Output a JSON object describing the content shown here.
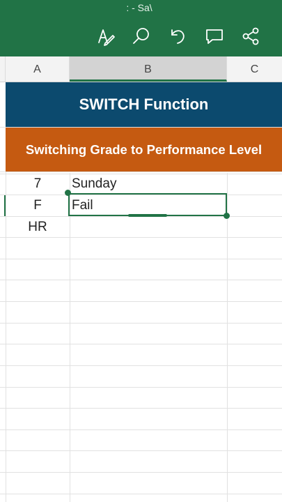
{
  "toolbar": {
    "title": ": - Sa\\",
    "icons": [
      "draw-pen-icon",
      "search-icon",
      "undo-icon",
      "comment-icon",
      "share-icon"
    ]
  },
  "columns": [
    "A",
    "B",
    "C"
  ],
  "selected_column": "B",
  "banners": {
    "title": "SWITCH Function",
    "subtitle": "Switching Grade to Performance Level"
  },
  "rows": [
    {
      "a": "7",
      "b": "Sunday"
    },
    {
      "a": "F",
      "b": "Fail"
    },
    {
      "a": "HR",
      "b": ""
    }
  ],
  "colors": {
    "ribbon": "#217346",
    "banner_title": "#0c4a6e",
    "banner_subtitle": "#c55a11"
  }
}
